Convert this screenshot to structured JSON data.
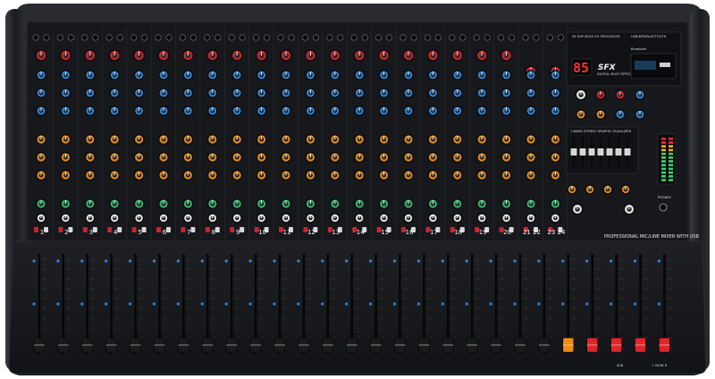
{
  "device": {
    "channel_count": 20,
    "stereo_channels": [
      "21/22",
      "23/24"
    ],
    "channel_numbers": [
      "1",
      "2",
      "3",
      "4",
      "5",
      "6",
      "7",
      "8",
      "9",
      "10",
      "11",
      "12",
      "13",
      "14",
      "15",
      "16",
      "17",
      "18",
      "19",
      "20",
      "21 22",
      "23 24"
    ],
    "fx_header": "99 DSP MULTI-FX PROCESSOR",
    "usb_header": "USB/MP3/BLUETOOTH",
    "fx_display_value": "85",
    "fx_logo": "SFX",
    "fx_subtitle": "DIGITAL MULTI EFFECT PROCESSOR",
    "bluetooth_label": "Bluetooth",
    "eq_title": "7-BAND STEREO GRAPHIC EQUALIZER",
    "eq_band_count": 7,
    "phones_label": "PHONES",
    "footer_text": "PROFESSIONAL MIC/LINE MIXER WITH USB",
    "master_fader_labels": [
      "SUB",
      "L  MAIN  R"
    ],
    "colors": {
      "chassis": "#1c1d20",
      "panel": "#15161a",
      "rail": "#0b0b0d",
      "knob_red": "#c8262c",
      "knob_blue": "#2f86d8",
      "knob_orange": "#e08a1e",
      "knob_green": "#2fb36b",
      "knob_white": "#e6e6e6",
      "fader_red": "#e2242a",
      "fader_orange": "#f08a12",
      "led_red": "#ff2a2a"
    }
  }
}
